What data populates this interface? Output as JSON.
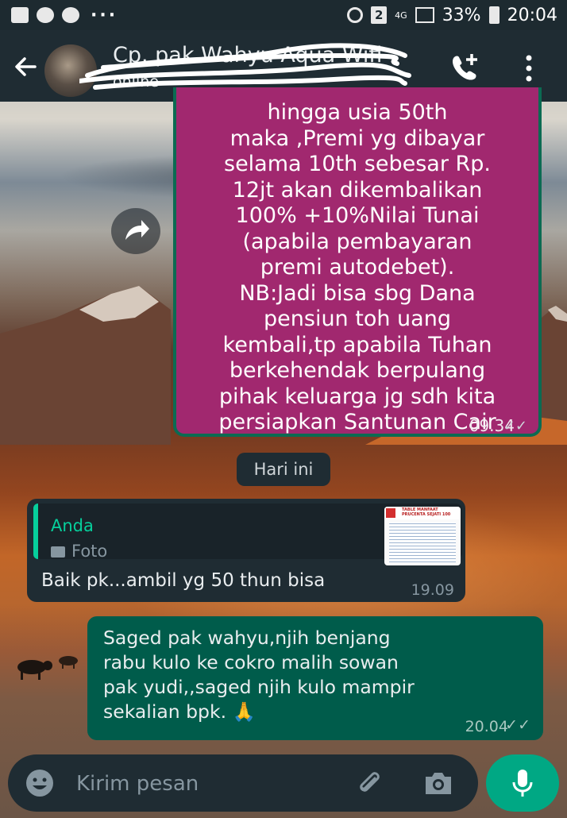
{
  "status_bar": {
    "sim_badge": "2",
    "network": "4G",
    "battery": "33%",
    "time": "20:04",
    "icons": [
      "image-icon",
      "chat-bubble-icon",
      "chat-bubble-icon",
      "more-dots-icon",
      "alarm-icon",
      "signal-icon",
      "battery-icon"
    ]
  },
  "header": {
    "contact_name": "Cp. pak Wahyu Aqua Wifi",
    "contact_status": "online",
    "icons": [
      "back-arrow-icon",
      "add-call-icon",
      "more-vert-icon"
    ]
  },
  "messages": {
    "forwarded": {
      "text": "hingga usia 50th\nmaka ,Premi yg dibayar\nselama 10th sebesar Rp.\n12jt akan dikembalikan\n100% +10%Nilai Tunai\n(apabila pembayaran\npremi autodebet).\nNB:Jadi bisa sbg Dana\npensiun toh uang\nkembali,tp apabila Tuhan\nberkehendak berpulang\npihak keluarga jg sdh kita\npersiapkan Santunan Cair",
      "time": "09.34",
      "ticks": "✓✓",
      "bubble_color": "#a1286f"
    },
    "date_separator": "Hari ini",
    "incoming": {
      "quote_author": "Anda",
      "quote_type": "Foto",
      "quote_thumb_title": "TABLE MANFAAT\nPRUCENTA SEJATI 100",
      "text": "Baik pk...ambil yg 50 thun bisa",
      "time": "19.09"
    },
    "outgoing": {
      "text": "Saged pak wahyu,njih benjang\nrabu kulo ke cokro malih sowan\npak yudi,,saged njih kulo mampir\nsekalian bpk. 🙏",
      "time": "20.04",
      "ticks": "✓✓"
    }
  },
  "input": {
    "placeholder": "Kirim pesan",
    "icons": [
      "emoji-icon",
      "attach-icon",
      "camera-icon",
      "mic-icon"
    ]
  },
  "colors": {
    "accent": "#00a884",
    "header_bg": "#1f2c33",
    "outgoing_bubble": "#005c4b",
    "incoming_bubble": "#1f2c33",
    "quote_green": "#06cf9c"
  }
}
